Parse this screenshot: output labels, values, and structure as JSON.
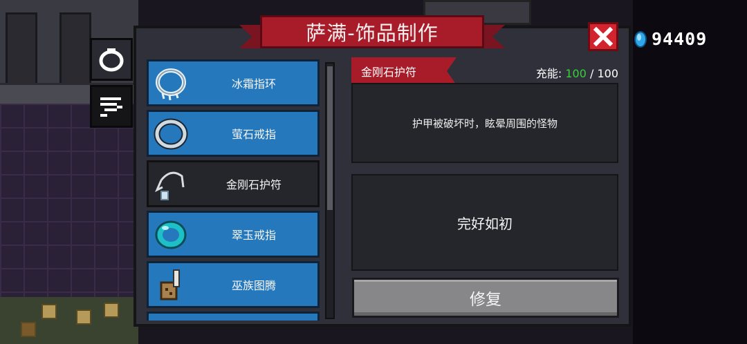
{
  "title": "萨满-饰品制作",
  "currency": {
    "icon": "gem-icon",
    "amount": "94409"
  },
  "tabs": [
    {
      "name": "ring-tab",
      "icon": "ring-icon",
      "active": true
    },
    {
      "name": "list-tab",
      "icon": "list-icon",
      "active": false
    }
  ],
  "items": [
    {
      "label": "冰霜指环",
      "icon": "frost-ring-icon",
      "selected": false
    },
    {
      "label": "萤石戒指",
      "icon": "fluorite-ring-icon",
      "selected": false
    },
    {
      "label": "金刚石护符",
      "icon": "diamond-amulet-icon",
      "selected": true
    },
    {
      "label": "翠玉戒指",
      "icon": "jade-ring-icon",
      "selected": false
    },
    {
      "label": "巫族图腾",
      "icon": "witch-totem-icon",
      "selected": false
    }
  ],
  "detail": {
    "name": "金刚石护符",
    "charge_label": "充能: ",
    "charge_current": "100",
    "charge_max": " / 100",
    "description": "护甲被破坏时，眩晕周围的怪物",
    "status": "完好如初",
    "repair_label": "修复"
  },
  "colors": {
    "banner": "#a81c2a",
    "item_bg": "#2578bb",
    "charge_current": "#36d23a",
    "close": "#d2232e"
  }
}
